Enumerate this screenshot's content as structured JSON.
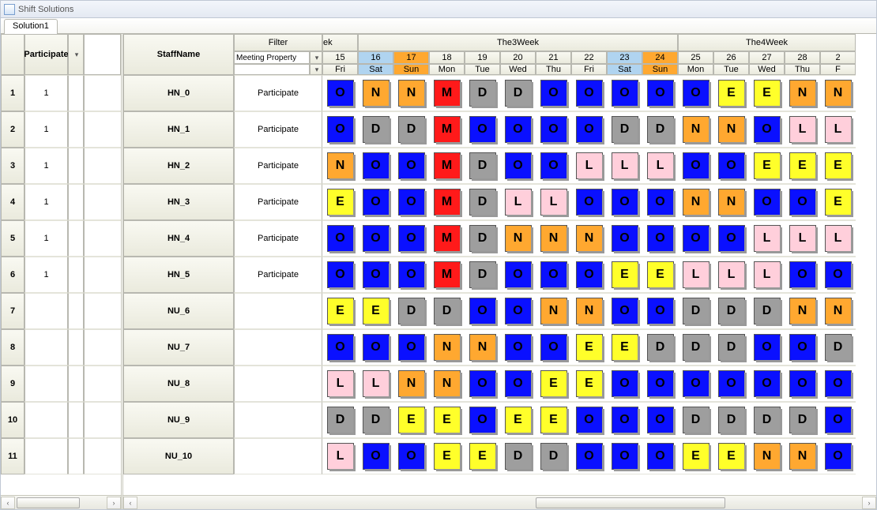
{
  "window": {
    "title": "Shift Solutions"
  },
  "tab": {
    "label": "Solution1"
  },
  "leftGrid": {
    "colHeader": "Participate",
    "rows": [
      {
        "idx": "1",
        "val": "1"
      },
      {
        "idx": "2",
        "val": "1"
      },
      {
        "idx": "3",
        "val": "1"
      },
      {
        "idx": "4",
        "val": "1"
      },
      {
        "idx": "5",
        "val": "1"
      },
      {
        "idx": "6",
        "val": "1"
      },
      {
        "idx": "7",
        "val": ""
      },
      {
        "idx": "8",
        "val": ""
      },
      {
        "idx": "9",
        "val": ""
      },
      {
        "idx": "10",
        "val": ""
      },
      {
        "idx": "11",
        "val": ""
      }
    ]
  },
  "rightGrid": {
    "staffHeader": "StaffName",
    "filterHeader": "Filter",
    "meetingProp": "Meeting Property",
    "weekFragments": [
      "ek",
      "The3Week",
      "The4Week"
    ],
    "days": [
      {
        "num": "15",
        "dow": "Fri",
        "sat": false,
        "sun": false
      },
      {
        "num": "16",
        "dow": "Sat",
        "sat": true,
        "sun": false
      },
      {
        "num": "17",
        "dow": "Sun",
        "sat": false,
        "sun": true
      },
      {
        "num": "18",
        "dow": "Mon",
        "sat": false,
        "sun": false
      },
      {
        "num": "19",
        "dow": "Tue",
        "sat": false,
        "sun": false
      },
      {
        "num": "20",
        "dow": "Wed",
        "sat": false,
        "sun": false
      },
      {
        "num": "21",
        "dow": "Thu",
        "sat": false,
        "sun": false
      },
      {
        "num": "22",
        "dow": "Fri",
        "sat": false,
        "sun": false
      },
      {
        "num": "23",
        "dow": "Sat",
        "sat": true,
        "sun": false
      },
      {
        "num": "24",
        "dow": "Sun",
        "sat": false,
        "sun": true
      },
      {
        "num": "25",
        "dow": "Mon",
        "sat": false,
        "sun": false
      },
      {
        "num": "26",
        "dow": "Tue",
        "sat": false,
        "sun": false
      },
      {
        "num": "27",
        "dow": "Wed",
        "sat": false,
        "sun": false
      },
      {
        "num": "28",
        "dow": "Thu",
        "sat": false,
        "sun": false
      },
      {
        "num": "2",
        "dow": "F",
        "sat": false,
        "sun": false
      }
    ],
    "rows": [
      {
        "staff": "HN_0",
        "filter": "Participate",
        "shifts": [
          "O",
          "N",
          "N",
          "M",
          "D",
          "D",
          "O",
          "O",
          "O",
          "O",
          "O",
          "E",
          "E",
          "N",
          "N"
        ]
      },
      {
        "staff": "HN_1",
        "filter": "Participate",
        "shifts": [
          "O",
          "D",
          "D",
          "M",
          "O",
          "O",
          "O",
          "O",
          "D",
          "D",
          "N",
          "N",
          "O",
          "L",
          "L"
        ]
      },
      {
        "staff": "HN_2",
        "filter": "Participate",
        "shifts": [
          "N",
          "O",
          "O",
          "M",
          "D",
          "O",
          "O",
          "L",
          "L",
          "L",
          "O",
          "O",
          "E",
          "E",
          "E"
        ]
      },
      {
        "staff": "HN_3",
        "filter": "Participate",
        "shifts": [
          "E",
          "O",
          "O",
          "M",
          "D",
          "L",
          "L",
          "O",
          "O",
          "O",
          "N",
          "N",
          "O",
          "O",
          "E"
        ]
      },
      {
        "staff": "HN_4",
        "filter": "Participate",
        "shifts": [
          "O",
          "O",
          "O",
          "M",
          "D",
          "N",
          "N",
          "N",
          "O",
          "O",
          "O",
          "O",
          "L",
          "L",
          "L"
        ]
      },
      {
        "staff": "HN_5",
        "filter": "Participate",
        "shifts": [
          "O",
          "O",
          "O",
          "M",
          "D",
          "O",
          "O",
          "O",
          "E",
          "E",
          "L",
          "L",
          "L",
          "O",
          "O"
        ]
      },
      {
        "staff": "NU_6",
        "filter": "",
        "shifts": [
          "E",
          "E",
          "D",
          "D",
          "O",
          "O",
          "N",
          "N",
          "O",
          "O",
          "D",
          "D",
          "D",
          "N",
          "N"
        ]
      },
      {
        "staff": "NU_7",
        "filter": "",
        "shifts": [
          "O",
          "O",
          "O",
          "N",
          "N",
          "O",
          "O",
          "E",
          "E",
          "D",
          "D",
          "D",
          "O",
          "O",
          "D"
        ]
      },
      {
        "staff": "NU_8",
        "filter": "",
        "shifts": [
          "L",
          "L",
          "N",
          "N",
          "O",
          "O",
          "E",
          "E",
          "O",
          "O",
          "O",
          "O",
          "O",
          "O",
          "O"
        ]
      },
      {
        "staff": "NU_9",
        "filter": "",
        "shifts": [
          "D",
          "D",
          "E",
          "E",
          "O",
          "E",
          "E",
          "O",
          "O",
          "O",
          "D",
          "D",
          "D",
          "D",
          "O"
        ]
      },
      {
        "staff": "NU_10",
        "filter": "",
        "shifts": [
          "L",
          "O",
          "O",
          "E",
          "E",
          "D",
          "D",
          "O",
          "O",
          "O",
          "E",
          "E",
          "N",
          "N",
          "O"
        ]
      }
    ]
  },
  "shiftColors": {
    "O": "c-O",
    "N": "c-N",
    "M": "c-M",
    "D": "c-D",
    "E": "c-E",
    "L": "c-L"
  }
}
